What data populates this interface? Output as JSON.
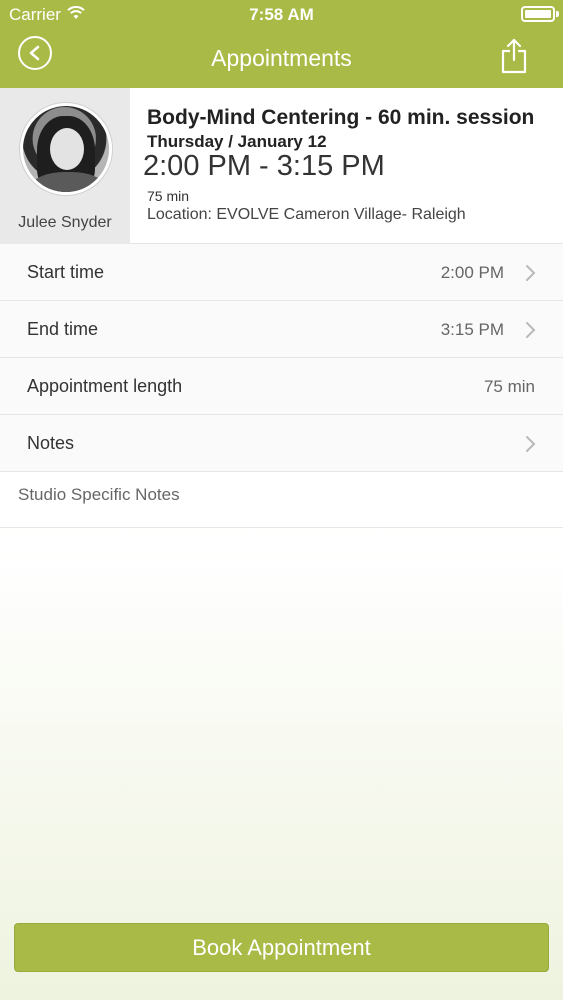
{
  "status_bar": {
    "carrier": "Carrier",
    "time": "7:58 AM"
  },
  "nav": {
    "title": "Appointments",
    "back_icon": "back-circle-icon",
    "share_icon": "share-icon"
  },
  "staff": {
    "name": "Julee Snyder"
  },
  "appointment": {
    "service": "Body-Mind Centering - 60 min. session",
    "date": "Thursday / January 12",
    "time_range": "2:00 PM - 3:15 PM",
    "length": "75 min",
    "location": "Location: EVOLVE Cameron Village- Raleigh"
  },
  "rows": {
    "start": {
      "label": "Start time",
      "value": "2:00 PM"
    },
    "end": {
      "label": "End time",
      "value": "3:15 PM"
    },
    "length": {
      "label": "Appointment length",
      "value": "75 min"
    },
    "notes": {
      "label": "Notes"
    }
  },
  "studio_notes_label": "Studio Specific Notes",
  "book_button": "Book Appointment",
  "colors": {
    "accent": "#a9bb46",
    "text": "#333333"
  }
}
